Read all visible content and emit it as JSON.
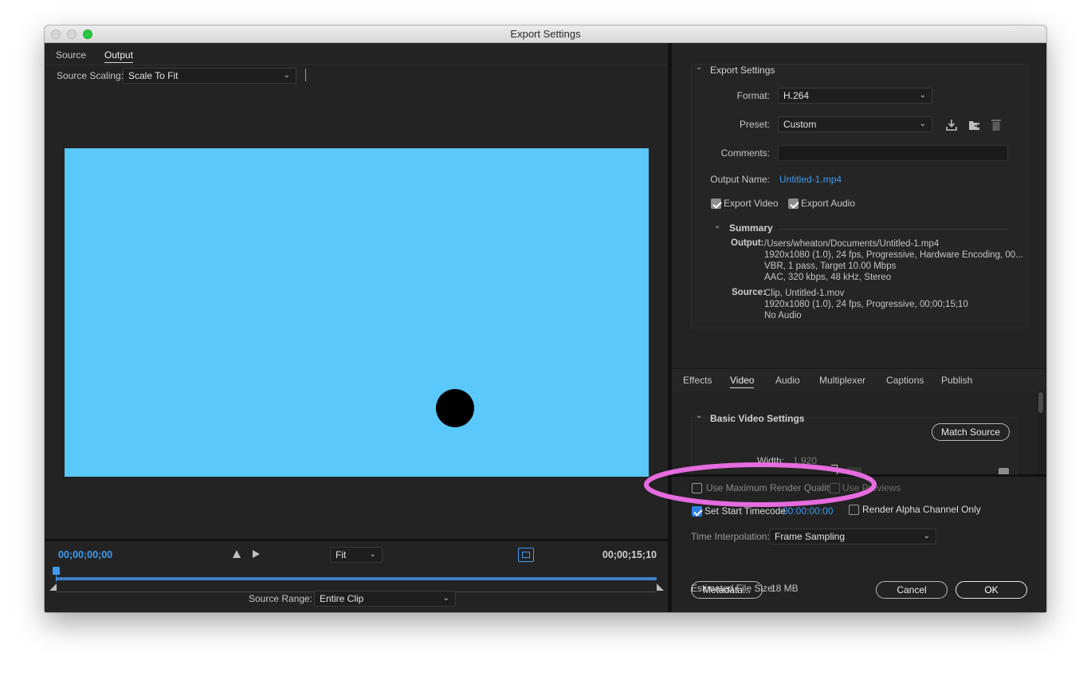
{
  "window": {
    "title": "Export Settings"
  },
  "left_tabs": [
    {
      "label": "Source"
    },
    {
      "label": "Output"
    }
  ],
  "source_scaling": {
    "label": "Source Scaling:",
    "value": "Scale To Fit"
  },
  "timeline": {
    "current_time": "00;00;00;00",
    "end_time": "00;00;15;10",
    "zoom": "Fit",
    "source_range_label": "Source Range:",
    "source_range_value": "Entire Clip"
  },
  "export_settings": {
    "heading": "Export Settings",
    "format_label": "Format:",
    "format_value": "H.264",
    "preset_label": "Preset:",
    "preset_value": "Custom",
    "comments_label": "Comments:",
    "comments_value": "",
    "output_name_label": "Output Name:",
    "output_name_value": "Untitled-1.mp4",
    "export_video_label": "Export Video",
    "export_video_checked": true,
    "export_audio_label": "Export Audio",
    "export_audio_checked": true
  },
  "summary": {
    "heading": "Summary",
    "output_label": "Output:",
    "output_lines": [
      "/Users/wheaton/Documents/Untitled-1.mp4",
      "1920x1080 (1.0), 24 fps, Progressive, Hardware Encoding, 00...",
      "VBR, 1 pass, Target 10.00 Mbps",
      "AAC, 320 kbps, 48 kHz, Stereo"
    ],
    "source_label": "Source:",
    "source_lines": [
      "Clip, Untitled-1.mov",
      "1920x1080 (1.0), 24 fps, Progressive, 00;00;15;10",
      "No Audio"
    ]
  },
  "settings_tabs": [
    {
      "label": "Effects"
    },
    {
      "label": "Video"
    },
    {
      "label": "Audio"
    },
    {
      "label": "Multiplexer"
    },
    {
      "label": "Captions"
    },
    {
      "label": "Publish"
    }
  ],
  "video_settings": {
    "heading": "Basic Video Settings",
    "match_source": "Match Source",
    "width_label": "Width:",
    "width_value": "1,920"
  },
  "bottom": {
    "max_render_label": "Use Maximum Render Quality",
    "use_previews_label": "Use Previews",
    "start_timecode_label": "Set Start Timecode",
    "start_timecode_value": "00:00:00:00",
    "start_timecode_checked": true,
    "alpha_label": "Render Alpha Channel Only",
    "time_interp_label": "Time Interpolation:",
    "time_interp_value": "Frame Sampling",
    "file_size_label": "Estimated File Size:",
    "file_size_value": "18 MB",
    "metadata_button": "Metadata...",
    "cancel_button": "Cancel",
    "ok_button": "OK"
  },
  "colors": {
    "preview": "#5ac8fa",
    "accent": "#3e9bf0",
    "highlight_ellipse": "#e66cdf"
  }
}
